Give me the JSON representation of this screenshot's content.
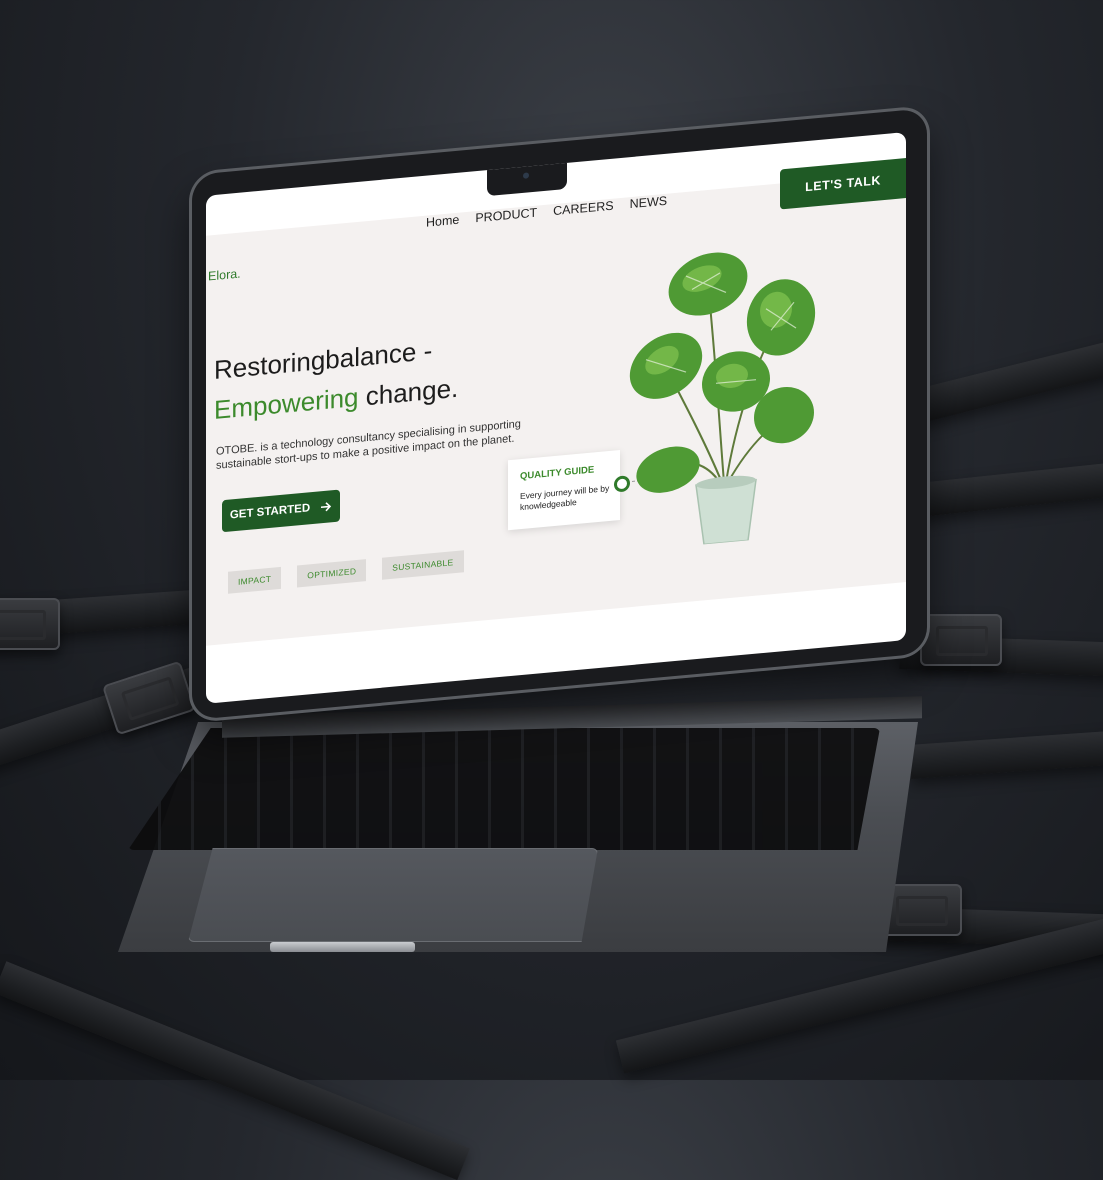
{
  "website": {
    "brand": "Elora.",
    "nav": [
      "Home",
      "PRODUCT",
      "CAREERS",
      "NEWS"
    ],
    "cta_talk": "LET'S TALK",
    "headline_line1": "Restoringbalance -",
    "headline_green": "Empowering",
    "headline_rest": " change.",
    "description": "OTOBE. is a technology consultancy specialising in supporting sustainable stort-ups to make a positive impact on the planet.",
    "get_started": "GET STARTED",
    "tags": [
      "IMPACT",
      "OPTIMIZED",
      "SUSTAINABLE"
    ],
    "guide_title": "QUALITY GUIDE",
    "guide_body": "Every journey will be by knowledgeable"
  },
  "colors": {
    "brand_green": "#1f5a25",
    "accent_green": "#3c8a2c",
    "page_bg": "#f4f1f0",
    "backdrop": "#24272d"
  },
  "icons": [
    "arrow-right-icon",
    "webcam-icon",
    "monstera-plant-illustration"
  ]
}
